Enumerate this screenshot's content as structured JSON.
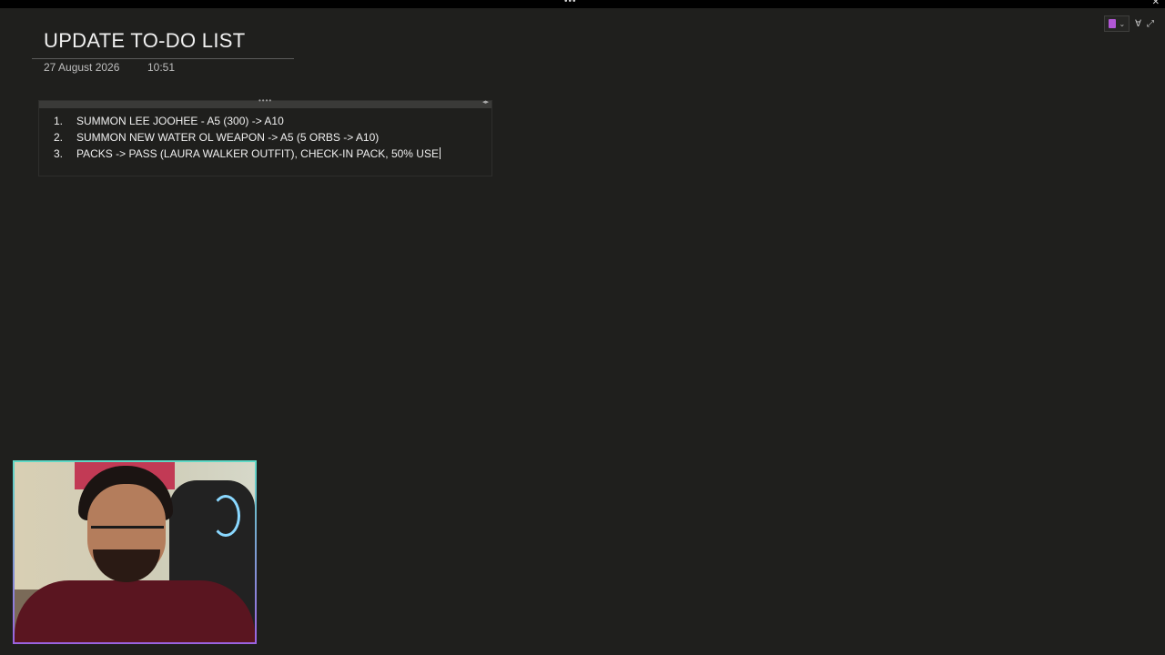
{
  "page": {
    "title": "UPDATE TO-DO LIST",
    "date": "27 August 2026",
    "time": "10:51"
  },
  "todo": {
    "items": [
      {
        "number": "1.",
        "text": "SUMMON LEE JOOHEE - A5 (300) -> A10"
      },
      {
        "number": "2.",
        "text": "SUMMON NEW WATER OL WEAPON -> A5 (5 ORBS -> A10)"
      },
      {
        "number": "3.",
        "text": "PACKS -> PASS (LAURA WALKER OUTFIT), CHECK-IN PACK, 50% USE"
      }
    ]
  },
  "toolbar": {
    "more_glyph": "•••",
    "close_glyph": "✕",
    "notebook_icon": "notebook-icon",
    "chevron": "⌄",
    "pin_glyph": "∀",
    "expand_glyph": "⤢"
  },
  "container": {
    "grip_glyph": "••••",
    "arrows_glyph": "◂▸"
  },
  "colors": {
    "background": "#1f1f1d",
    "text": "#f0f0f0",
    "notebook_accent": "#b257d6",
    "webcam_border_top": "#5fd9c5",
    "webcam_border_bottom": "#9b63e0"
  }
}
